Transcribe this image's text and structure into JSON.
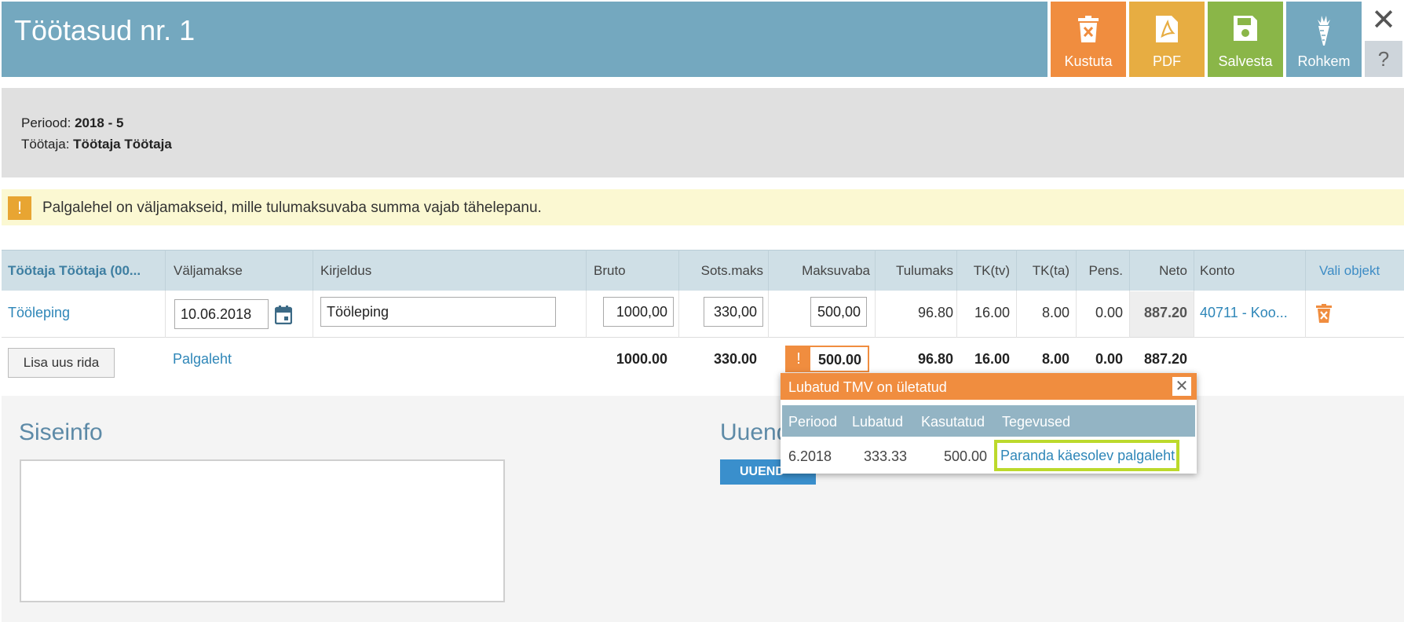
{
  "header": {
    "title": "Töötasud nr. 1",
    "buttons": {
      "delete": "Kustuta",
      "pdf": "PDF",
      "save": "Salvesta",
      "more": "Rohkem"
    },
    "close": "✕",
    "help": "?"
  },
  "info": {
    "period_label": "Periood:",
    "period_value": "2018 - 5",
    "employee_label": "Töötaja:",
    "employee_value": "Töötaja Töötaja"
  },
  "warning": {
    "icon": "!",
    "text": "Palgalehel on väljamakseid, mille tulumaksuvaba summa vajab tähelepanu."
  },
  "table": {
    "headers": {
      "employee": "Töötaja Töötaja (00...",
      "payout": "Väljamakse",
      "description": "Kirjeldus",
      "bruto": "Bruto",
      "sots": "Sots.maks",
      "maksuvaba": "Maksuvaba",
      "tulumaks": "Tulumaks",
      "tktv": "TK(tv)",
      "tkta": "TK(ta)",
      "pens": "Pens.",
      "neto": "Neto",
      "konto": "Konto",
      "vali": "Vali objekt"
    },
    "row": {
      "type": "Tööleping",
      "date": "10.06.2018",
      "description": "Tööleping",
      "bruto": "1000,00",
      "sots": "330,00",
      "maksuvaba": "500,00",
      "tulumaks": "96.80",
      "tktv": "16.00",
      "tkta": "8.00",
      "pens": "0.00",
      "neto": "887.20",
      "konto": "40711 - Koo..."
    },
    "totals": {
      "add_row": "Lisa uus rida",
      "label": "Palgaleht",
      "bruto": "1000.00",
      "sots": "330.00",
      "maksuvaba": "500.00",
      "tulumaks": "96.80",
      "tktv": "16.00",
      "tkta": "8.00",
      "pens": "0.00",
      "neto": "887.20"
    }
  },
  "siseinfo": {
    "title": "Siseinfo",
    "value": ""
  },
  "uuend": {
    "title": "Uuend",
    "button": "UUEND"
  },
  "popup": {
    "title": "Lubatud TMV on ületatud",
    "close": "✕",
    "headers": [
      "Periood",
      "Lubatud",
      "Kasutatud",
      "Tegevused"
    ],
    "row": {
      "periood": "6.2018",
      "lubatud": "333.33",
      "kasutatud": "500.00",
      "action": "Paranda käesolev palgaleht"
    }
  },
  "colors": {
    "header_bg": "#74a8bf",
    "delete": "#f08d3f",
    "pdf": "#e7ad42",
    "save": "#8ab648",
    "more": "#74a8bf",
    "link": "#2e86b8",
    "highlight": "#bcd92c"
  },
  "icons": {
    "delete": "trash-icon",
    "pdf": "pdf-icon",
    "save": "floppy-icon",
    "more": "carrot-icon",
    "calendar": "calendar-icon",
    "row_delete": "trash-icon"
  }
}
